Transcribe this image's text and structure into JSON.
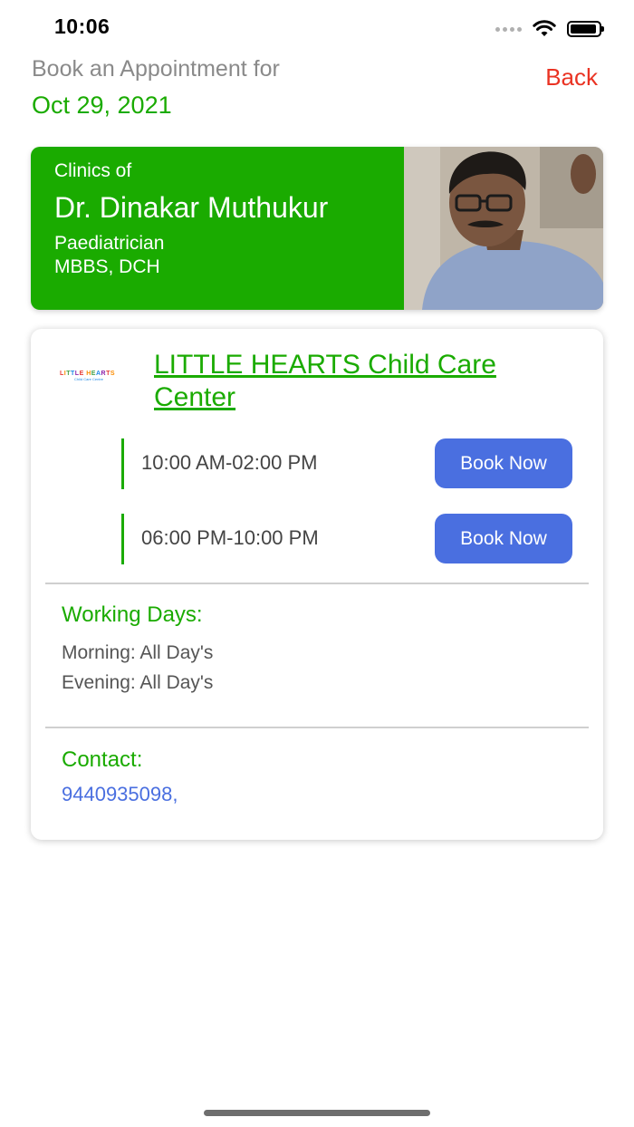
{
  "status_bar": {
    "time": "10:06"
  },
  "header": {
    "subtitle": "Book an Appointment for",
    "date": "Oct 29, 2021",
    "back_label": "Back"
  },
  "doctor": {
    "clinics_of": "Clinics of",
    "name": "Dr. Dinakar Muthukur",
    "specialization": "Paediatrician",
    "degree": "MBBS, DCH"
  },
  "clinic": {
    "logo_text": "LITTLE HEARTS",
    "logo_subtext": "Child Care Centre",
    "name": "LITTLE HEARTS  Child Care Center",
    "slots": [
      {
        "time": "10:00 AM-02:00 PM",
        "button_label": "Book Now"
      },
      {
        "time": "06:00 PM-10:00 PM",
        "button_label": "Book Now"
      }
    ],
    "working_days": {
      "title": "Working Days:",
      "morning": "Morning: All Day's",
      "evening": "Evening: All Day's"
    },
    "contact": {
      "title": "Contact:",
      "phone": "9440935098,"
    }
  },
  "colors": {
    "brand_green": "#1aab00",
    "back_red": "#ea3323",
    "button_blue": "#4a6fe0"
  }
}
